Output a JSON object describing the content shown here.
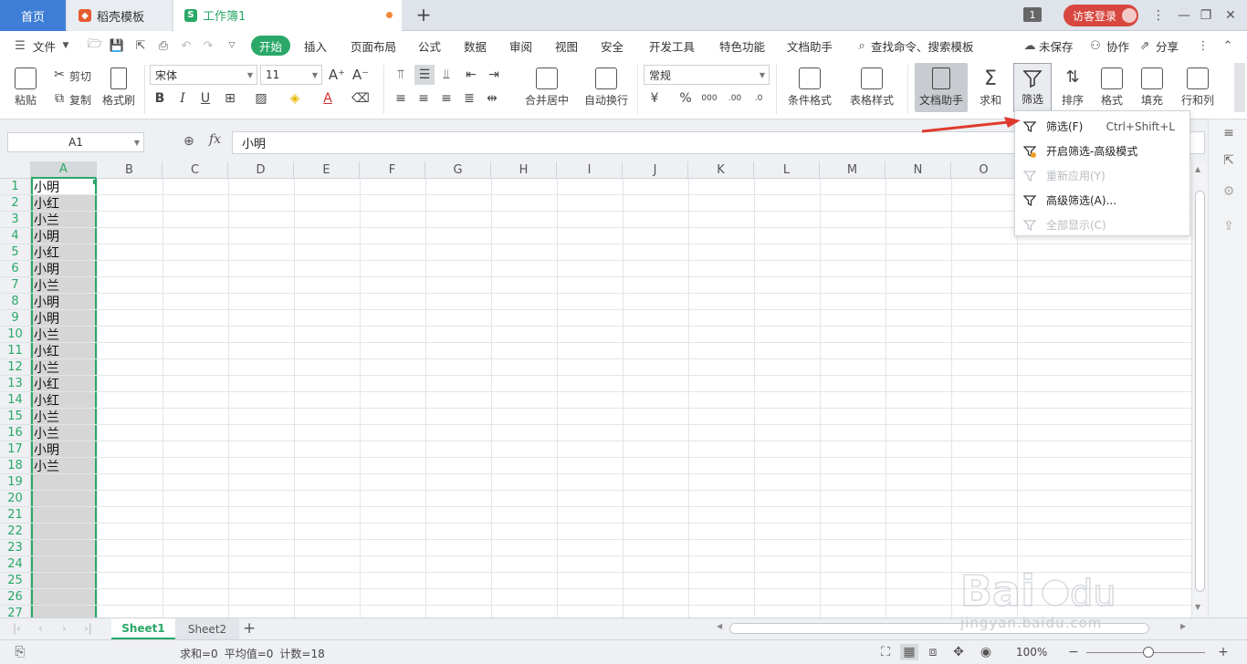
{
  "tabs": {
    "home": "首页",
    "docer": "稻壳模板",
    "workbook": "工作簿1"
  },
  "window": {
    "count": "1",
    "login": "访客登录"
  },
  "menu": {
    "file": "文件",
    "start": "开始",
    "insert": "插入",
    "page_layout": "页面布局",
    "formula": "公式",
    "data": "数据",
    "review": "审阅",
    "view": "视图",
    "security": "安全",
    "developer": "开发工具",
    "special": "特色功能",
    "doc_assist": "文档助手",
    "search": "查找命令、搜索模板",
    "unsaved": "未保存",
    "collab": "协作",
    "share": "分享"
  },
  "ribbon": {
    "paste": "粘贴",
    "cut": "剪切",
    "copy": "复制",
    "format_painter": "格式刷",
    "font_name": "宋体",
    "font_size": "11",
    "merge_center": "合并居中",
    "auto_wrap": "自动换行",
    "number_format": "常规",
    "cond_format": "条件格式",
    "table_style": "表格样式",
    "doc_assist": "文档助手",
    "sum": "求和",
    "filter": "筛选",
    "sort": "排序",
    "format": "格式",
    "fill": "填充",
    "row_col": "行和列"
  },
  "formula_bar": {
    "name_box": "A1",
    "fx": "fx",
    "content": "小明"
  },
  "grid": {
    "columns": [
      "A",
      "B",
      "C",
      "D",
      "E",
      "F",
      "G",
      "H",
      "I",
      "J",
      "K",
      "L",
      "M",
      "N",
      "O"
    ],
    "rows": [
      "1",
      "2",
      "3",
      "4",
      "5",
      "6",
      "7",
      "8",
      "9",
      "10",
      "11",
      "12",
      "13",
      "14",
      "15",
      "16",
      "17",
      "18",
      "19",
      "20",
      "21",
      "22",
      "23",
      "24",
      "25",
      "26",
      "27"
    ],
    "column_a_values": [
      "小明",
      "小红",
      "小兰",
      "小明",
      "小红",
      "小明",
      "小兰",
      "小明",
      "小明",
      "小兰",
      "小红",
      "小兰",
      "小红",
      "小红",
      "小兰",
      "小兰",
      "小明",
      "小兰"
    ]
  },
  "sheets": {
    "sheet1": "Sheet1",
    "sheet2": "Sheet2"
  },
  "status": {
    "sum": "求和=0",
    "avg": "平均值=0",
    "count": "计数=18",
    "zoom": "100%"
  },
  "filter_menu": {
    "items": [
      {
        "label": "筛选(F)",
        "shortcut": "Ctrl+Shift+L",
        "enabled": true
      },
      {
        "label": "开启筛选-高级模式",
        "shortcut": "",
        "enabled": true
      },
      {
        "label": "重新应用(Y)",
        "shortcut": "",
        "enabled": false
      },
      {
        "label": "高级筛选(A)...",
        "shortcut": "",
        "enabled": true
      },
      {
        "label": "全部显示(C)",
        "shortcut": "",
        "enabled": false
      }
    ]
  },
  "watermark": {
    "brand": "Baidu经验",
    "url": "jingyan.baidu.com"
  },
  "colors": {
    "accent_green": "#2aa868",
    "home_tab": "#3f7ed6",
    "login_red": "#d7473f",
    "arrow_red": "#e03a2f"
  }
}
